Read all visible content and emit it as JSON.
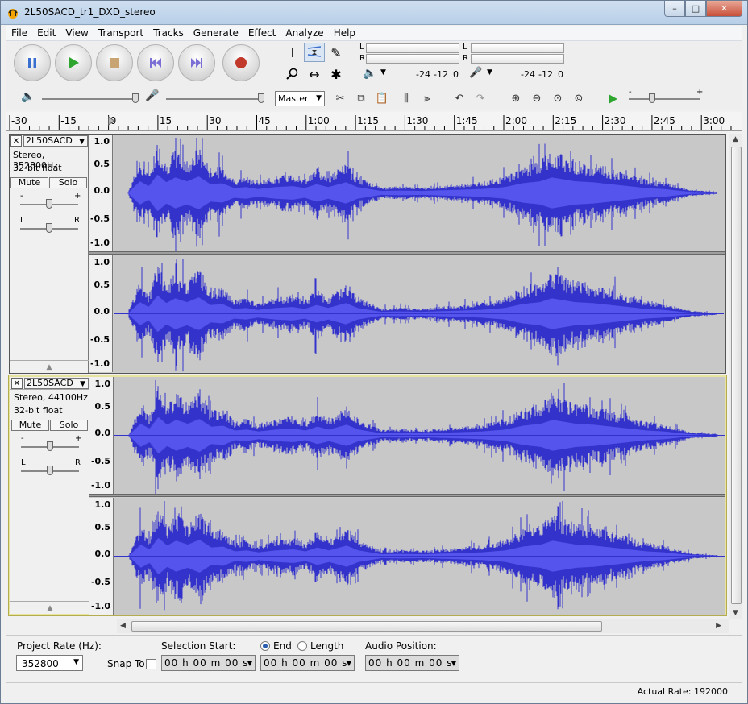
{
  "window": {
    "title": "2L50SACD_tr1_DXD_stereo",
    "minimize": "–",
    "maximize": "□",
    "close": "✕"
  },
  "menu": [
    "File",
    "Edit",
    "View",
    "Transport",
    "Tracks",
    "Generate",
    "Effect",
    "Analyze",
    "Help"
  ],
  "transport": {
    "icons": [
      "pause-icon",
      "play-icon",
      "stop-icon",
      "skip-to-start-icon",
      "skip-to-end-icon",
      "record-icon"
    ],
    "colors": {
      "blue": "#3a6fcf",
      "green": "#2ea52e",
      "stop": "#c7a472",
      "record": "#c0392b"
    }
  },
  "meters": {
    "play_L": "L",
    "play_R": "R",
    "rec_L": "L",
    "rec_R": "R",
    "play_scale": [
      "-24",
      "-12",
      "0"
    ],
    "rec_scale": [
      "-24",
      "-12",
      "0"
    ]
  },
  "mixer": {
    "output_device": "Master"
  },
  "ruler": {
    "labels": [
      "-30",
      "-15",
      "0",
      "15",
      "30",
      "45",
      "1:00",
      "1:15",
      "1:30",
      "1:45",
      "2:00",
      "2:15",
      "2:30",
      "2:45",
      "3:00"
    ]
  },
  "tracks": [
    {
      "name": "2L50SACD",
      "info1": "Stereo, 352800Hz",
      "info2": "32-bit float",
      "mute": "Mute",
      "solo": "Solo",
      "gain_minus": "-",
      "gain_plus": "+",
      "pan_left": "L",
      "pan_right": "R"
    },
    {
      "name": "2L50SACD",
      "info1": "Stereo, 44100Hz",
      "info2": "32-bit float",
      "mute": "Mute",
      "solo": "Solo",
      "gain_minus": "-",
      "gain_plus": "+",
      "pan_left": "L",
      "pan_right": "R"
    }
  ],
  "amplitude_ticks": [
    "1.0",
    "0.5",
    "0.0",
    "-0.5",
    "-1.0"
  ],
  "waveform_color": "#3333cc",
  "selection": {
    "project_rate_label": "Project Rate (Hz):",
    "project_rate": "352800",
    "snap_to": "Snap To",
    "selection_start_label": "Selection Start:",
    "end_label": "End",
    "length_label": "Length",
    "audio_position_label": "Audio Position:",
    "start_time": "00 h 00 m 00 s",
    "end_time": "00 h 00 m 00 s",
    "audio_time": "00 h 00 m 00 s"
  },
  "status": {
    "actual_rate": "Actual Rate: 192000"
  }
}
